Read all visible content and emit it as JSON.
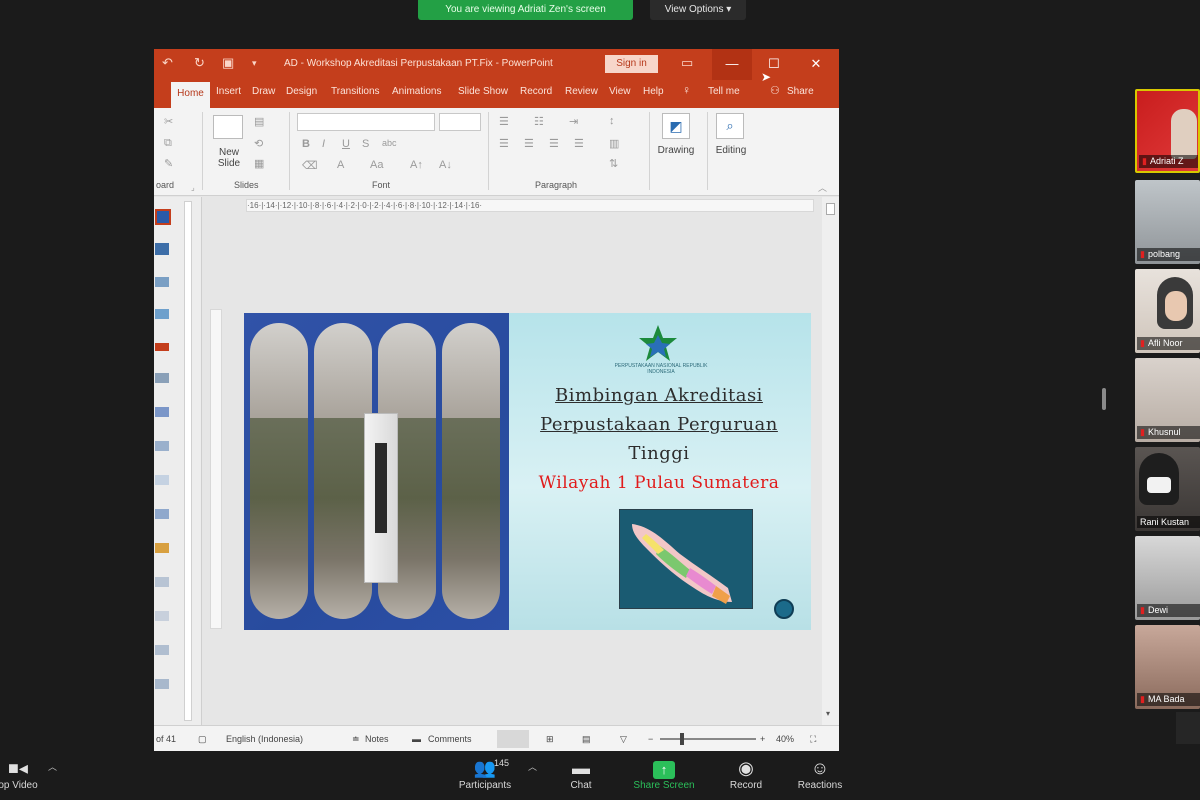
{
  "zoom": {
    "banner": "You are viewing Adriati Zen's screen",
    "view_options": "View Options ▾",
    "toolbar": {
      "video_label": "op Video",
      "participants_label": "Participants",
      "participants_count": "145",
      "chat_label": "Chat",
      "share_label": "Share Screen",
      "record_label": "Record",
      "reactions_label": "Reactions"
    },
    "participants": [
      {
        "name": "Adriati Z"
      },
      {
        "name": "polbang"
      },
      {
        "name": "Afli Noor"
      },
      {
        "name": "Khusnul"
      },
      {
        "name": "Rani Kustan"
      },
      {
        "name": "Dewi"
      },
      {
        "name": "MA Bada"
      }
    ]
  },
  "ppt": {
    "window_title": "AD - Workshop Akreditasi Perpustakaan PT.Fix - PowerPoint",
    "signin": "Sign in",
    "tabs": [
      "Home",
      "Insert",
      "Draw",
      "Design",
      "Transitions",
      "Animations",
      "Slide Show",
      "Record",
      "Review",
      "View",
      "Help"
    ],
    "tell_me": "Tell me",
    "share": "Share",
    "ribbon": {
      "clipboard": "oard",
      "slides": "Slides",
      "font": "Font",
      "paragraph": "Paragraph",
      "new_slide": "New Slide",
      "drawing": "Drawing",
      "editing": "Editing"
    },
    "ruler": "·16·|·14·|·12·|·10·|·8·|·6·|·4·|·2·|·0·|·2·|·4·|·6·|·8·|·10·|·12·|·14·|·16·",
    "slide": {
      "logo_text": "PERPUSTAKAAN NASIONAL REPUBLIK INDONESIA",
      "title_line1": "Bimbingan Akreditasi",
      "title_line2": "Perpustakaan Perguruan",
      "title_line3": "Tinggi",
      "subtitle": "Wilayah 1 Pulau Sumatera"
    },
    "status": {
      "slide_count": "of 41",
      "language": "English (Indonesia)",
      "notes": "Notes",
      "comments": "Comments",
      "zoom": "40%"
    }
  },
  "colors": {
    "ppt_accent": "#c43e1c",
    "zoom_green": "#23a045",
    "slide_title_red": "#e11b1b"
  }
}
